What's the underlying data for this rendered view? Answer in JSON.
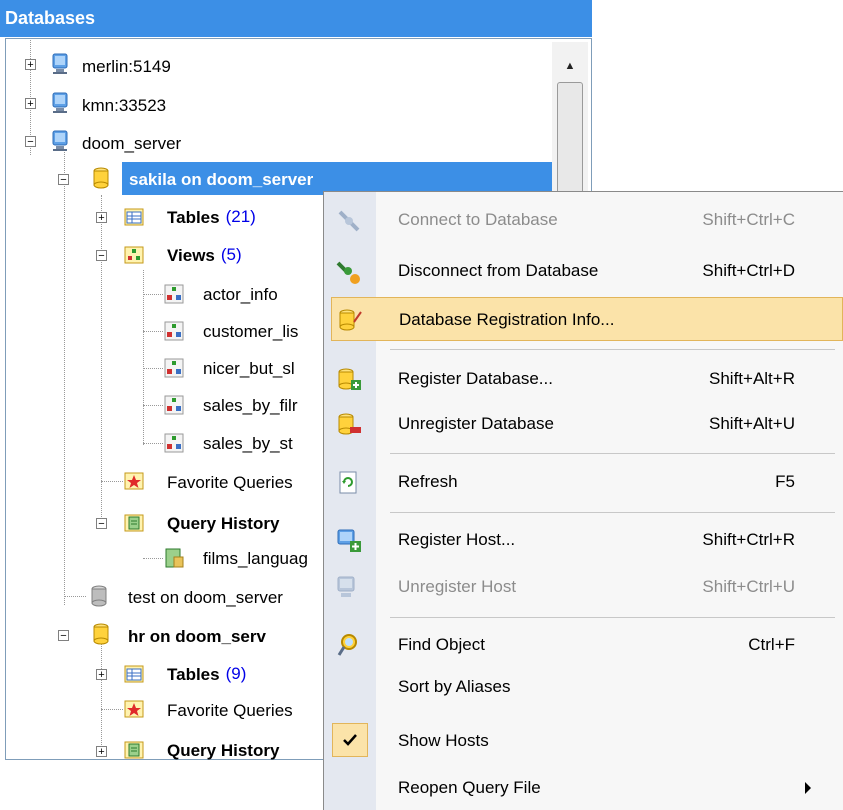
{
  "panel": {
    "title": "Databases"
  },
  "tree": {
    "hosts": [
      {
        "label": "merlin:5149"
      },
      {
        "label": "kmn:33523"
      },
      {
        "label": "doom_server"
      }
    ],
    "sakila": {
      "label": "sakila on doom_server",
      "tables_label": "Tables",
      "tables_count": "(21)",
      "views_label": "Views",
      "views_count": "(5)",
      "views": [
        "actor_info",
        "customer_lis",
        "nicer_but_sl",
        "sales_by_filr",
        "sales_by_st"
      ],
      "favorite_queries": "Favorite Queries",
      "query_history": "Query History",
      "history_items": [
        "films_languag"
      ]
    },
    "test": {
      "label": "test on doom_server"
    },
    "hr": {
      "label": "hr on doom_serv",
      "tables_label": "Tables",
      "tables_count": "(9)",
      "favorite_queries": "Favorite Queries",
      "query_history": "Query History"
    }
  },
  "menu": {
    "items": [
      {
        "label": "Connect to Database",
        "shortcut": "Shift+Ctrl+C",
        "icon": "connect-icon",
        "disabled": true
      },
      {
        "label": "Disconnect from Database",
        "shortcut": "Shift+Ctrl+D",
        "icon": "disconnect-icon"
      },
      {
        "label": "Database Registration Info...",
        "shortcut": "",
        "icon": "registration-info-icon",
        "highlighted": true
      },
      {
        "label": "Register Database...",
        "shortcut": "Shift+Alt+R",
        "icon": "register-database-icon"
      },
      {
        "label": "Unregister Database",
        "shortcut": "Shift+Alt+U",
        "icon": "unregister-database-icon"
      },
      {
        "label": "Refresh",
        "shortcut": "F5",
        "icon": "refresh-icon"
      },
      {
        "label": "Register Host...",
        "shortcut": "Shift+Ctrl+R",
        "icon": "register-host-icon"
      },
      {
        "label": "Unregister Host",
        "shortcut": "Shift+Ctrl+U",
        "icon": "unregister-host-icon",
        "disabled": true
      },
      {
        "label": "Find Object",
        "shortcut": "Ctrl+F",
        "icon": "find-object-icon"
      },
      {
        "label": "Sort by Aliases",
        "shortcut": ""
      },
      {
        "label": "Show Hosts",
        "shortcut": "",
        "icon": "checkmark-icon",
        "checked": true
      },
      {
        "label": "Reopen Query File",
        "shortcut": "",
        "submenu": true
      }
    ]
  },
  "colors": {
    "header_blue": "#3c8fe6",
    "highlight": "#fbe3a9",
    "count_blue": "#0000e8"
  }
}
